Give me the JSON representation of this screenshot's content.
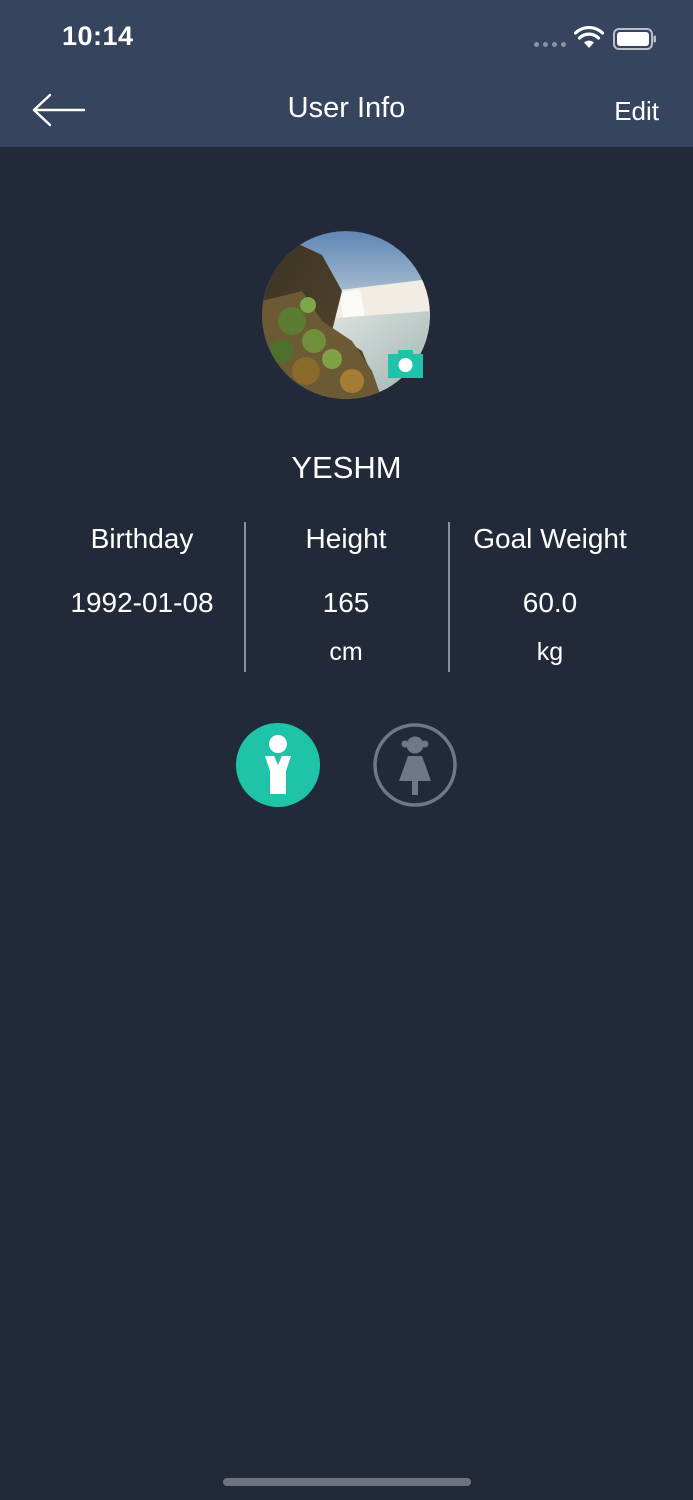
{
  "status_bar": {
    "time": "10:14"
  },
  "nav": {
    "title": "User Info",
    "edit_label": "Edit",
    "back_icon": "arrow-left-icon"
  },
  "profile": {
    "username": "YESHM",
    "avatar_icon": "waterfall-landscape-photo",
    "camera_icon": "camera-icon"
  },
  "stats": [
    {
      "label": "Birthday",
      "value": "1992-01-08",
      "unit": ""
    },
    {
      "label": "Height",
      "value": "165",
      "unit": "cm"
    },
    {
      "label": "Goal Weight",
      "value": "60.0",
      "unit": "kg"
    }
  ],
  "gender": {
    "selected": "male",
    "options": [
      "male",
      "female"
    ]
  },
  "colors": {
    "background": "#222a3a",
    "header": "#36455d",
    "accent": "#1fc3a7",
    "inactive": "#6f7889"
  }
}
